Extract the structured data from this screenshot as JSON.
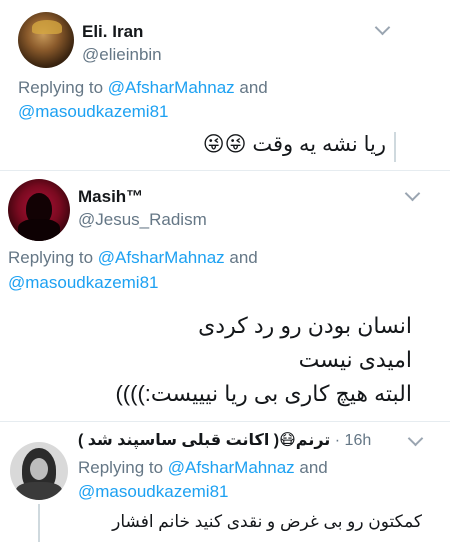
{
  "tweets": [
    {
      "display_name": "Eli. Iran",
      "handle": "@elieinbin",
      "reply_prefix": "Replying to",
      "reply_line1_mention": "@AfsharMahnaz",
      "reply_line1_suffix": " and",
      "reply_line2_mention": "@masoudkazemi81",
      "body": [
        "ریا نشه یه وقت 😜😜"
      ]
    },
    {
      "display_name": "Masih™",
      "handle": "@Jesus_Radism",
      "reply_prefix": "Replying to",
      "reply_line1_mention": "@AfsharMahnaz",
      "reply_line1_suffix": " and",
      "reply_line2_mention": "@masoudkazemi81",
      "body": [
        "انسان بودن رو رد کردی",
        "امیدی نیست",
        "البته هیچ کاری بی ریا نیییست:))))"
      ]
    },
    {
      "display_name": "ترنم😷( اکانت قبلی ساسپند شد )",
      "time": "· 16h",
      "reply_prefix": "Replying to",
      "reply_line1_mention": "@AfsharMahnaz",
      "reply_line1_suffix": " and",
      "reply_line2_mention": "@masoudkazemi81",
      "body": [
        "کمکتون رو بی غرض و نقدی کنید خانم افشار"
      ]
    }
  ],
  "icons": {
    "more": "chevron-down-icon"
  },
  "colors": {
    "link": "#1da1f2",
    "secondary": "#657786",
    "divider": "#e6ecf0"
  }
}
